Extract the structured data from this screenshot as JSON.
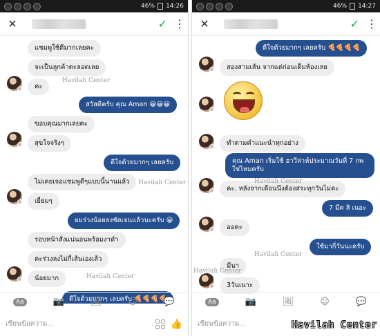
{
  "left": {
    "status": {
      "time": "14:26",
      "battery": "46%"
    },
    "messages": {
      "m1": "แชมพูใช้ดีมากเลยคะ",
      "m2": "จะเป็นลูกค้าตะลอดเลย",
      "m3": "คะ",
      "m4": "สวัสดีครับ คุณ Aman 😀😀😀",
      "m5": "ขอบคุณมากเลยคะ",
      "m6": "สุขใจจริงๆ",
      "m7": "ดีใจด้วยมากๆ เลยครับ",
      "m8": "ไม่เคยเจอแชมพูดีๆแบบนี้นานแล้ว",
      "m9": "เยี่ยมๆ",
      "m10": "ผมร่วงน้อยลงชัดเจนแล้วนะครับ 😀",
      "m11": "รอบหน้าสั่งแน่นอนพร้อมงาดำ",
      "m12": "คะร่วงลงไม่กี่เส้นเองเล้ว",
      "m13": "น้อยมาก",
      "m14": "ดีใจด้วยมากๆ เลยครับ 🍕🍕🍕🍕"
    },
    "watermarks": [
      "Havilah Center",
      "Havilah Center",
      "Havilah Center"
    ]
  },
  "right": {
    "status": {
      "time": "14:27",
      "battery": "46%"
    },
    "messages": {
      "m1": "ดีใจด้วยมากๆ เลยครับ 🍕🍕🍕🍕",
      "m2": "สองสามเส้น จากแต่ก่อนเต็มห้องเลย",
      "m3": "ทำตามคำแนะนำทุกอย่าง",
      "m4a": "คุณ Aman เริ่มใช้ ฮาวีล่าห์ประมาณวันที่ 7 กพ",
      "m4b": "ใช่ไหมครับ",
      "m5": "คะ. หลังจากเดือนนึงต้องสระทุกวันไม่คะ",
      "m6": "7 มีค สิ เนอะ",
      "m7": "ออคะ",
      "m8": "ใช้มากี่วันนะครับ",
      "m9": "มีนา",
      "m10": "3วันเนาะ"
    },
    "watermarks": [
      "Havilah Center",
      "Havilah Center",
      "Havilah Center"
    ]
  },
  "composer": {
    "placeholder": "เขียนข้อความ...",
    "aa_label": "Aa"
  },
  "brand": "Havilah Center"
}
